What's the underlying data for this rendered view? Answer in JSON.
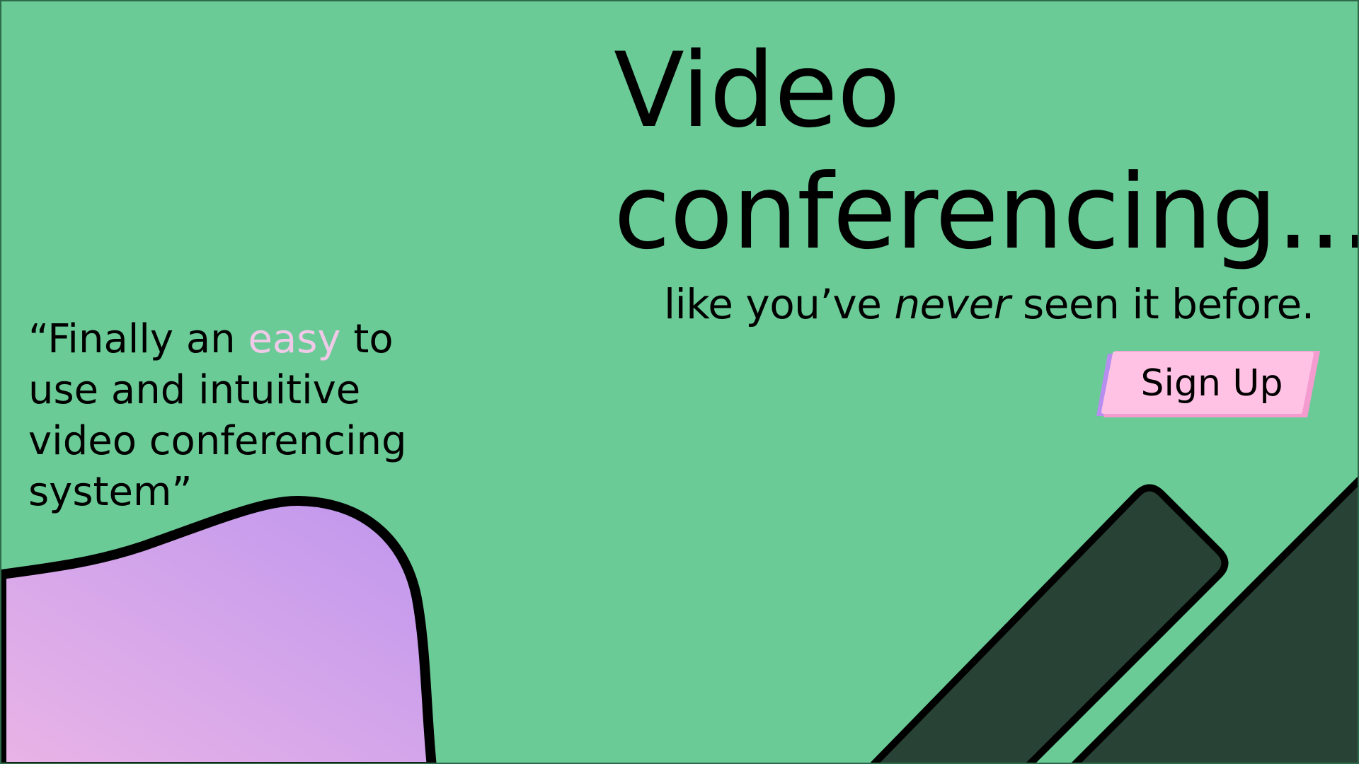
{
  "hero": {
    "headline_line1": "Video",
    "headline_line2": "conferencing...",
    "tagline_before": "like you’ve ",
    "tagline_emphasis": "never",
    "tagline_after": " seen it before."
  },
  "cta": {
    "signup_label": "Sign Up"
  },
  "testimonial": {
    "open_quote_part": "“Finally an ",
    "highlight_word": "easy",
    "rest": " to use and intuitive video conferencing system”"
  },
  "colors": {
    "background": "#6acb96",
    "highlight": "#f1c9e8",
    "button_fill": "#ffc2e4",
    "button_shadow_left": "#b68ef0",
    "button_shadow_right": "#f49cd0",
    "blob_gradient_start": "#e9b4e6",
    "blob_gradient_end": "#bf96ee",
    "dark_shapes": "#284235"
  }
}
